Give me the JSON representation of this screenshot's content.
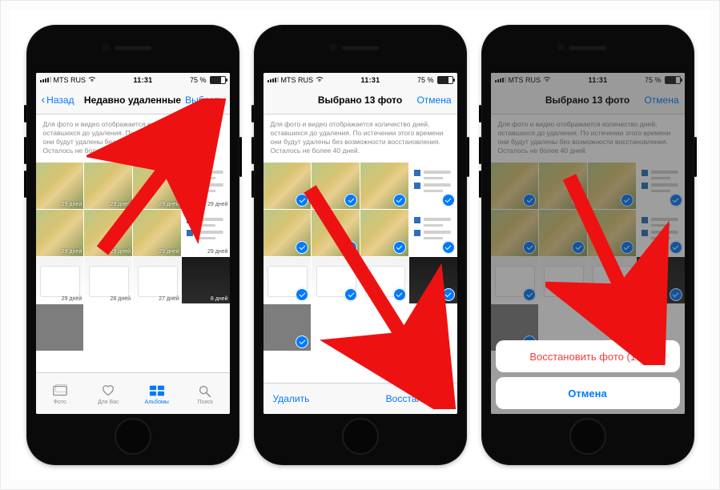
{
  "statusbar": {
    "carrier": "MTS RUS",
    "time": "11:31",
    "battery": "75 %"
  },
  "screen1": {
    "nav": {
      "back": "Назад",
      "title": "Недавно удаленные",
      "action": "Выбрать"
    },
    "info": "Для фото и видео отображается количество дней, оставшихся до удаления. По истечении этого времени они будут удалены без возможности восстановления. Осталось не более 40 дней.",
    "tabs": {
      "photos": "Фото",
      "foryou": "Для Вас",
      "albums": "Альбомы",
      "search": "Поиск"
    },
    "badges": {
      "d29": "29 дней",
      "d28": "28 дней",
      "d27": "27 дней",
      "d8": "8 дней"
    }
  },
  "screen2": {
    "nav": {
      "title": "Выбрано 13 фото",
      "action": "Отмена"
    },
    "info": "Для фото и видео отображается количество дней, оставшихся до удаления. По истечении этого времени они будут удалены без возможности восстановления. Осталось не более 40 дней.",
    "toolbar": {
      "left": "Удалить",
      "right": "Восстановить"
    }
  },
  "screen3": {
    "nav": {
      "title": "Выбрано 13 фото",
      "action": "Отмена"
    },
    "info": "Для фото и видео отображается количество дней, оставшихся до удаления. По истечении этого времени они будут удалены без возможности восстановления. Осталось не более 40 дней.",
    "sheet": {
      "recover": "Восстановить фото (13)",
      "cancel": "Отмена"
    }
  }
}
